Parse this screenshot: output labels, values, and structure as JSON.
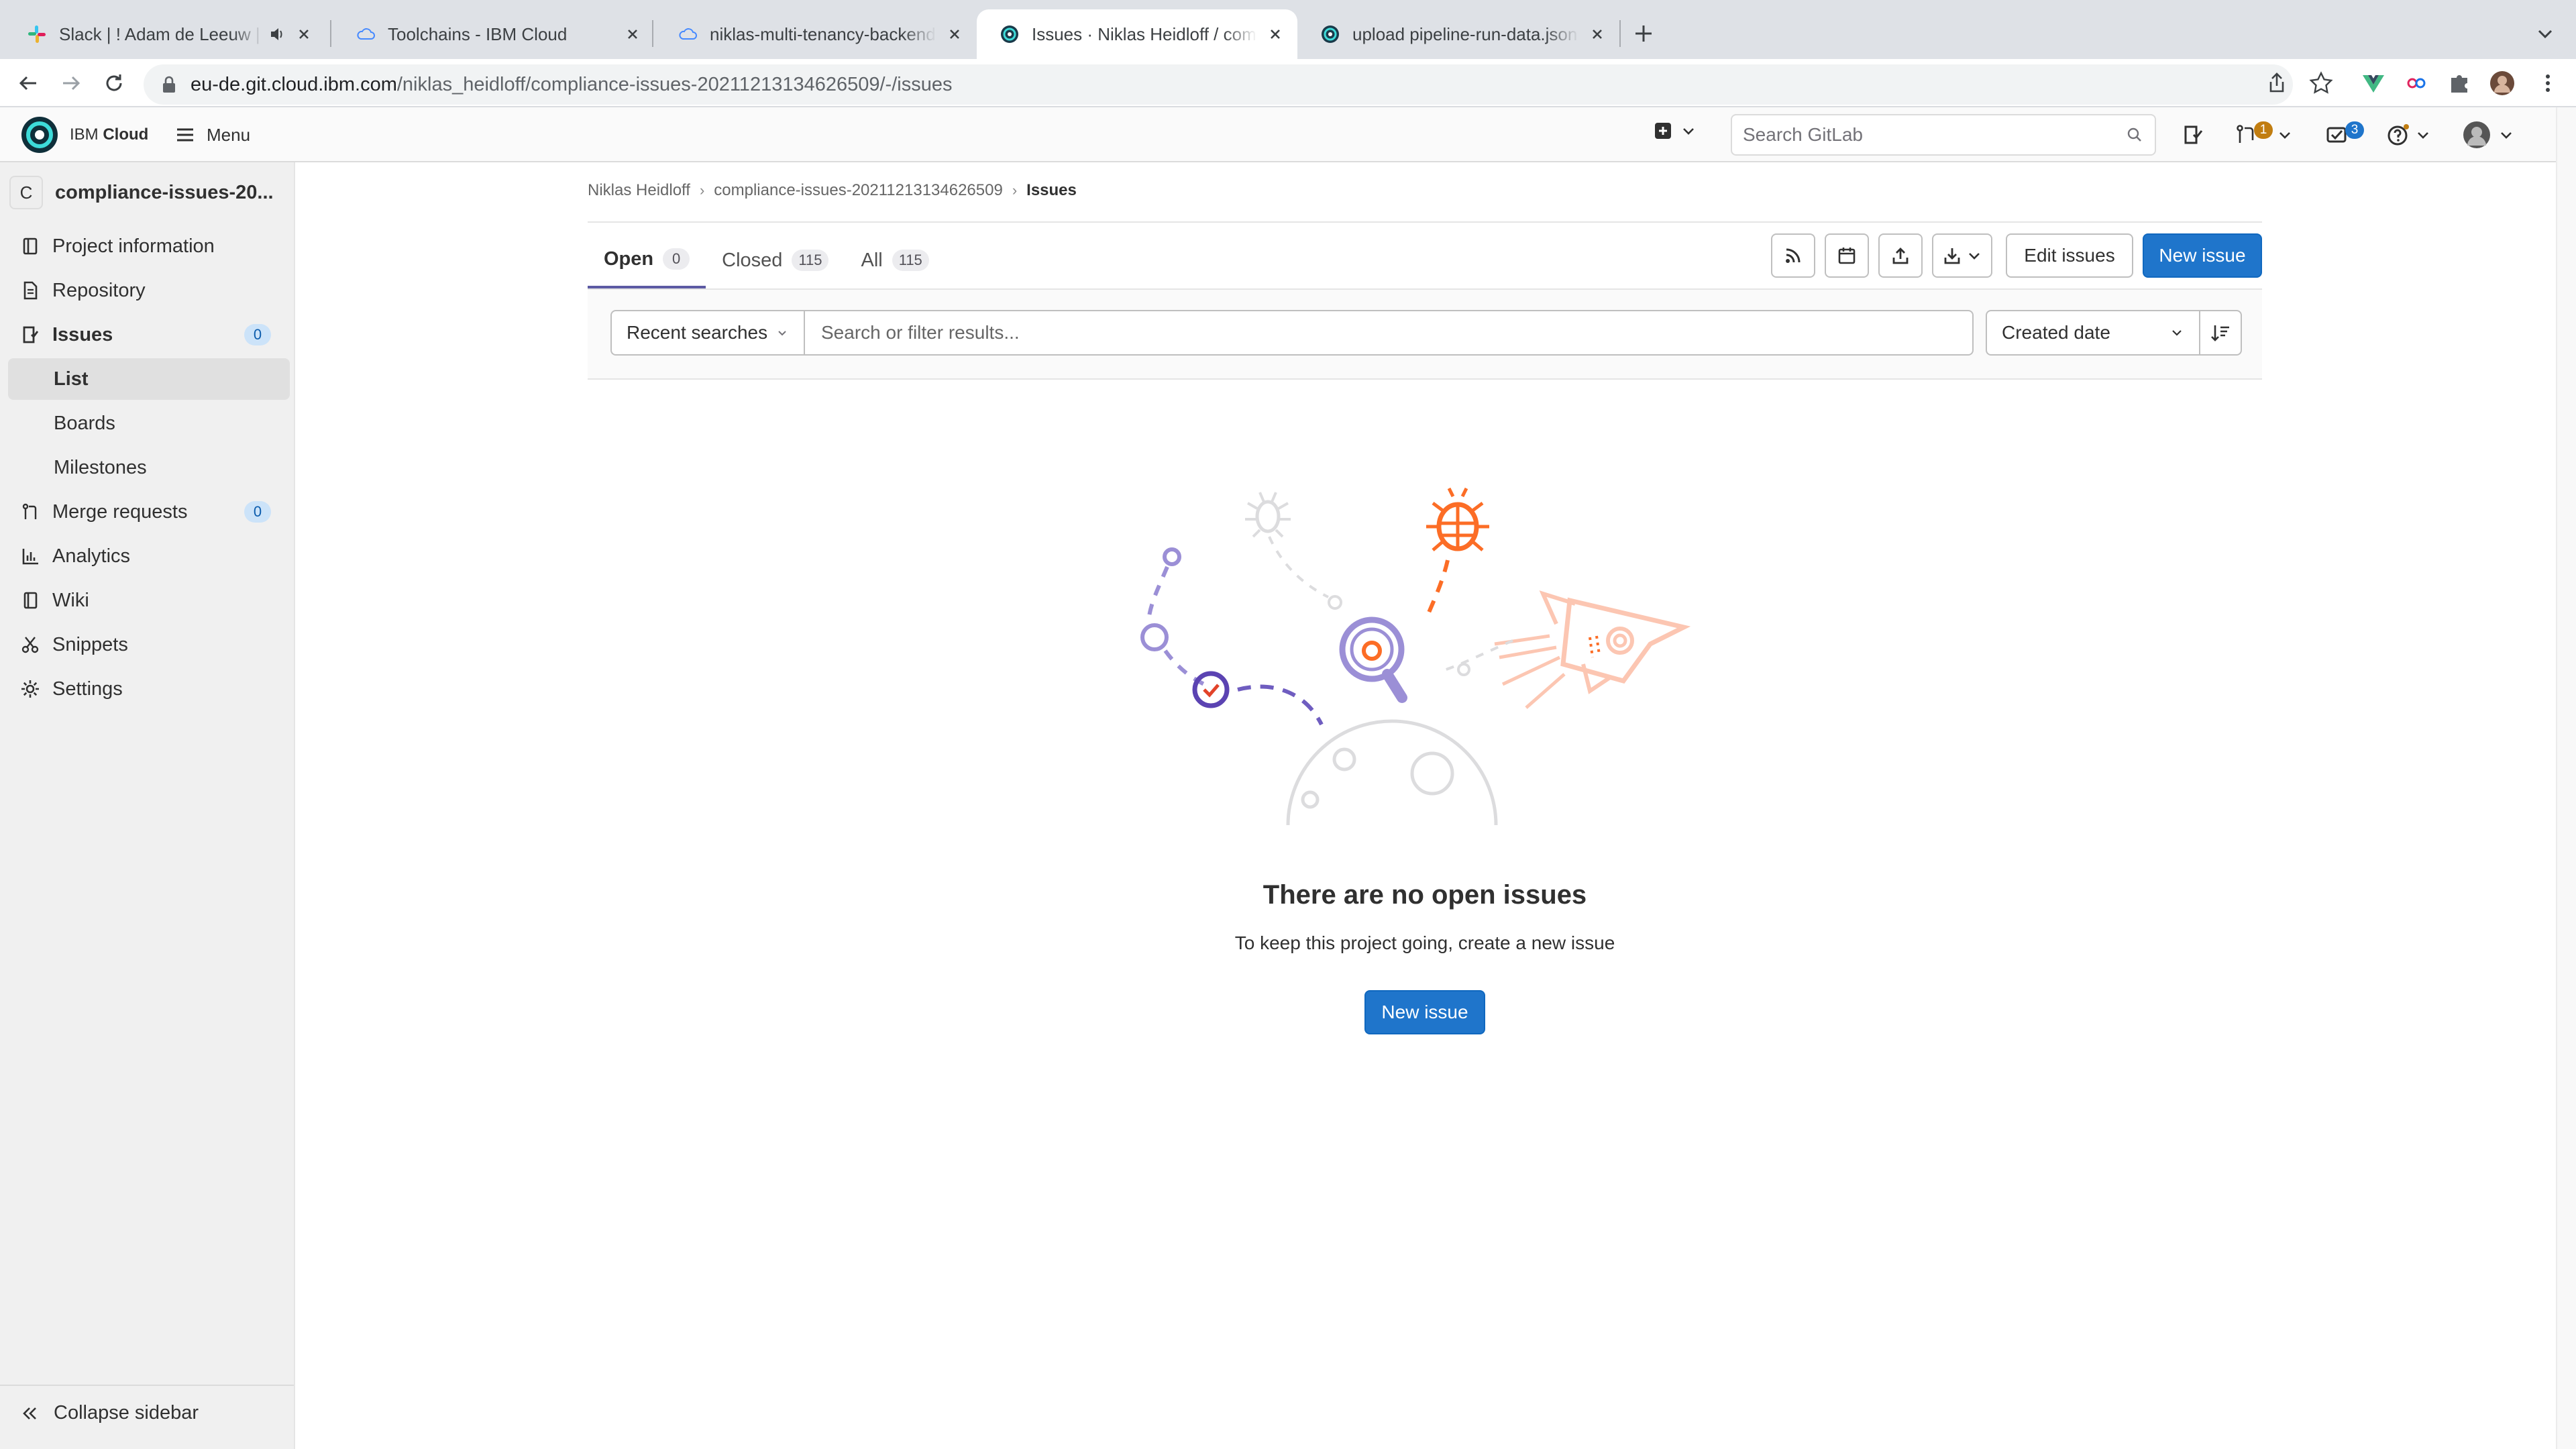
{
  "browser": {
    "tabs": [
      {
        "title": "Slack | ! Adam de Leeuw | IBM",
        "active": false
      },
      {
        "title": "Toolchains - IBM Cloud",
        "active": false
      },
      {
        "title": "niklas-multi-tenancy-backend-",
        "active": false
      },
      {
        "title": "Issues · Niklas Heidloff / compliance",
        "active": true
      },
      {
        "title": "upload pipeline-run-data.json ·",
        "active": false
      }
    ],
    "url_host": "eu-de.git.cloud.ibm.com",
    "url_path": "/niklas_heidloff/compliance-issues-20211213134626509/-/issues"
  },
  "header": {
    "brand_prefix": "IBM ",
    "brand_bold": "Cloud",
    "menu_label": "Menu",
    "search_placeholder": "Search GitLab",
    "mr_count": "1",
    "todo_count": "3"
  },
  "sidebar": {
    "project_initial": "C",
    "project_name": "compliance-issues-20...",
    "items": [
      {
        "label": "Project information",
        "icon": "project-icon"
      },
      {
        "label": "Repository",
        "icon": "doc-icon"
      },
      {
        "label": "Issues",
        "icon": "issues-icon",
        "count": "0"
      },
      {
        "label": "List"
      },
      {
        "label": "Boards"
      },
      {
        "label": "Milestones"
      },
      {
        "label": "Merge requests",
        "icon": "merge-request-icon",
        "count": "0"
      },
      {
        "label": "Analytics",
        "icon": "chart-icon"
      },
      {
        "label": "Wiki",
        "icon": "book-icon"
      },
      {
        "label": "Snippets",
        "icon": "scissors-icon"
      },
      {
        "label": "Settings",
        "icon": "gear-icon"
      }
    ],
    "collapse_label": "Collapse sidebar"
  },
  "breadcrumb": [
    "Niklas Heidloff",
    "compliance-issues-20211213134626509",
    "Issues"
  ],
  "issue_tabs": [
    {
      "label": "Open",
      "count": "0"
    },
    {
      "label": "Closed",
      "count": "115"
    },
    {
      "label": "All",
      "count": "115"
    }
  ],
  "actions": {
    "edit_issues": "Edit issues",
    "new_issue": "New issue"
  },
  "filter": {
    "recent_searches": "Recent searches",
    "placeholder": "Search or filter results...",
    "sort_by": "Created date"
  },
  "empty_state": {
    "title": "There are no open issues",
    "subtitle": "To keep this project going, create a new issue",
    "button": "New issue"
  },
  "colors": {
    "primary_button": "#1f75cb",
    "active_tab_underline": "#5c5aa3",
    "mr_badge": "#c17d10",
    "todo_badge": "#1f75cb"
  }
}
